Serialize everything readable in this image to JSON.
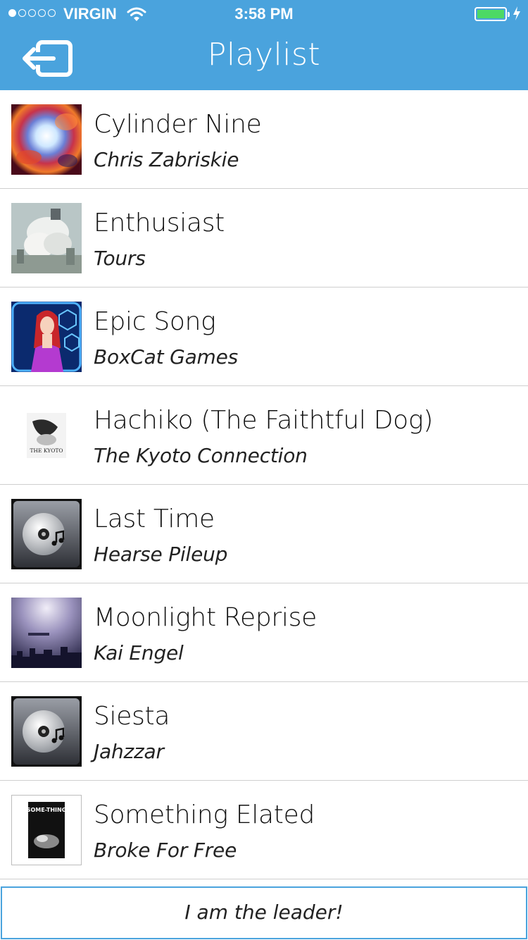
{
  "status_bar": {
    "carrier": "VIRGIN",
    "time": "3:58 PM",
    "signal_strength": 1,
    "signal_max": 5,
    "battery_level": 1.0,
    "wifi_icon": "wifi-icon",
    "charging_icon": "bolt-icon"
  },
  "nav": {
    "title": "Playlist",
    "back_icon": "exit-arrow-icon"
  },
  "playlist": [
    {
      "title": "Cylinder Nine",
      "artist": "Chris Zabriskie",
      "art": "cosmic-nebula-art"
    },
    {
      "title": "Enthusiast",
      "artist": "Tours",
      "art": "cloud-city-art"
    },
    {
      "title": "Epic Song",
      "artist": "BoxCat Games",
      "art": "anime-girl-art"
    },
    {
      "title": "Hachiko (The Faithtful Dog)",
      "artist": "The Kyoto Connection",
      "art": "kyoto-album-art",
      "art_text": "THE KYOTO"
    },
    {
      "title": "Last Time",
      "artist": "Hearse Pileup",
      "art": "music-disc-placeholder-icon"
    },
    {
      "title": "Moonlight Reprise",
      "artist": "Kai Engel",
      "art": "night-skyline-art"
    },
    {
      "title": "Siesta",
      "artist": "Jahzzar",
      "art": "music-disc-placeholder-icon"
    },
    {
      "title": "Something Elated",
      "artist": "Broke For Free",
      "art": "something-album-art",
      "art_text": "SOME-THING"
    }
  ],
  "footer": {
    "leader_label": "I am the leader!"
  },
  "colors": {
    "accent": "#4aa3dd",
    "battery": "#4cd964",
    "divider": "#cfcfcf"
  }
}
